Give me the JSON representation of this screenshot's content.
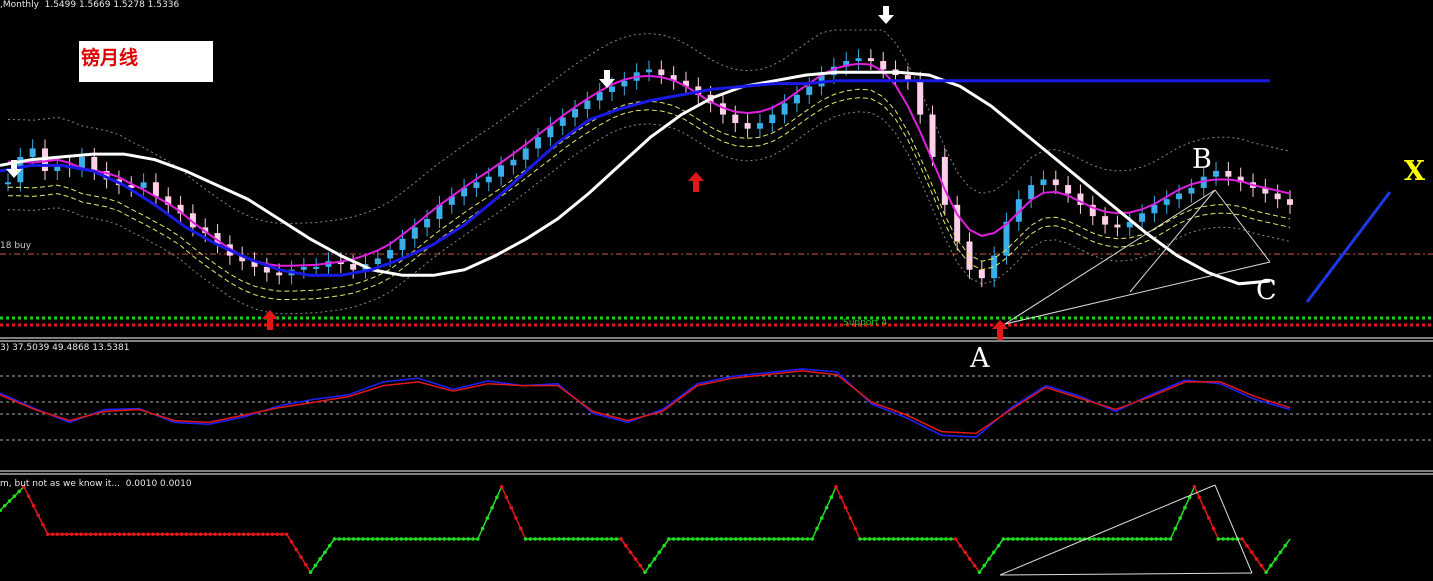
{
  "header": {
    "main": ",Monthly  1.5499 1.5669 1.5278 1.5336",
    "oscillator": "3) 37.5039 49.4868 13.5381",
    "zigzag": "m, but not as we know it...  0.0010 0.0010"
  },
  "title_box": {
    "text": "镑月线"
  },
  "labels": {
    "buy": "18 buy",
    "support": "Support 4"
  },
  "points": {
    "a": "A",
    "b": "B",
    "c": "C",
    "x": "X"
  },
  "colors": {
    "bull_candle": "#3aaee8",
    "bear_candle": "#ffd0e8",
    "ma_white": "#ffffff",
    "ma_blue": "#1a1ae6",
    "ma_magenta": "#e020e0",
    "ma_yellow": "#e8e86a",
    "osc_blue": "#2020ff",
    "osc_red": "#e01818",
    "zz_green": "#20e020",
    "zz_red": "#e01818",
    "support_green": "#20d020"
  },
  "chart_data": [
    {
      "type": "candlestick",
      "title": "Monthly",
      "series": [
        {
          "name": "price",
          "values": [
            46,
            55,
            58,
            50,
            52,
            51,
            55,
            50,
            47,
            45,
            44,
            46,
            41,
            38,
            35,
            30,
            28,
            24,
            20,
            18,
            16,
            14,
            13,
            15,
            16,
            16,
            18,
            17,
            15,
            17,
            19,
            22,
            26,
            30,
            33,
            38,
            41,
            44,
            46,
            48,
            52,
            54,
            58,
            62,
            66,
            69,
            72,
            75,
            78,
            80,
            82,
            85,
            86,
            84,
            82,
            80,
            77,
            74,
            70,
            67,
            65,
            67,
            70,
            74,
            77,
            80,
            84,
            87,
            89,
            90,
            89,
            86,
            84,
            82,
            70,
            55,
            38,
            25,
            15,
            12,
            20,
            32,
            40,
            45,
            47,
            45,
            42,
            38,
            34,
            31,
            30,
            32,
            35,
            38,
            40,
            42,
            44,
            48,
            50,
            48,
            46,
            44,
            42,
            40,
            38
          ]
        },
        {
          "name": "ma_white",
          "values": [
            52,
            54,
            55,
            56,
            56,
            54,
            50,
            45,
            40,
            33,
            26,
            20,
            15,
            13,
            13,
            15,
            20,
            26,
            33,
            42,
            52,
            62,
            70,
            76,
            80,
            82,
            84,
            85,
            85,
            85,
            84,
            80,
            73,
            64,
            55,
            46,
            37,
            28,
            20,
            14,
            10,
            11
          ]
        },
        {
          "name": "ma_blue",
          "values": [
            50,
            52,
            52,
            50,
            45,
            38,
            30,
            24,
            19,
            15,
            13,
            13,
            15,
            19,
            24,
            31,
            40,
            50,
            60,
            68,
            72,
            75,
            77,
            79,
            80,
            81,
            81,
            82,
            82,
            82,
            82,
            82,
            82,
            82,
            82,
            82,
            82,
            82,
            82,
            82,
            82,
            82
          ]
        }
      ],
      "grid": false
    },
    {
      "type": "line",
      "series": [
        {
          "name": "osc_blue",
          "values": [
            62,
            45,
            30,
            44,
            45,
            30,
            28,
            36,
            48,
            55,
            60,
            74,
            78,
            66,
            75,
            70,
            72,
            40,
            30,
            44,
            72,
            80,
            84,
            88,
            85,
            50,
            35,
            16,
            14,
            46,
            70,
            58,
            42,
            60,
            76,
            72,
            55,
            44
          ]
        },
        {
          "name": "osc_red",
          "values": [
            60,
            44,
            32,
            42,
            44,
            32,
            30,
            38,
            46,
            52,
            58,
            70,
            74,
            64,
            72,
            70,
            70,
            42,
            32,
            42,
            70,
            78,
            82,
            86,
            82,
            52,
            38,
            20,
            18,
            44,
            68,
            56,
            44,
            58,
            74,
            74,
            58,
            46
          ]
        }
      ],
      "levels": [
        80,
        60,
        50,
        20
      ]
    },
    {
      "type": "line",
      "series": [
        {
          "name": "zigzag",
          "values": [
            70,
            95,
            45,
            45,
            45,
            45,
            45,
            45,
            45,
            45,
            45,
            45,
            45,
            5,
            40,
            40,
            40,
            40,
            40,
            40,
            40,
            95,
            40,
            40,
            40,
            40,
            40,
            5,
            40,
            40,
            40,
            40,
            40,
            40,
            40,
            95,
            40,
            40,
            40,
            40,
            40,
            5,
            40,
            40,
            40,
            40,
            40,
            40,
            40,
            40,
            95,
            40,
            40,
            5,
            40
          ]
        }
      ]
    }
  ]
}
